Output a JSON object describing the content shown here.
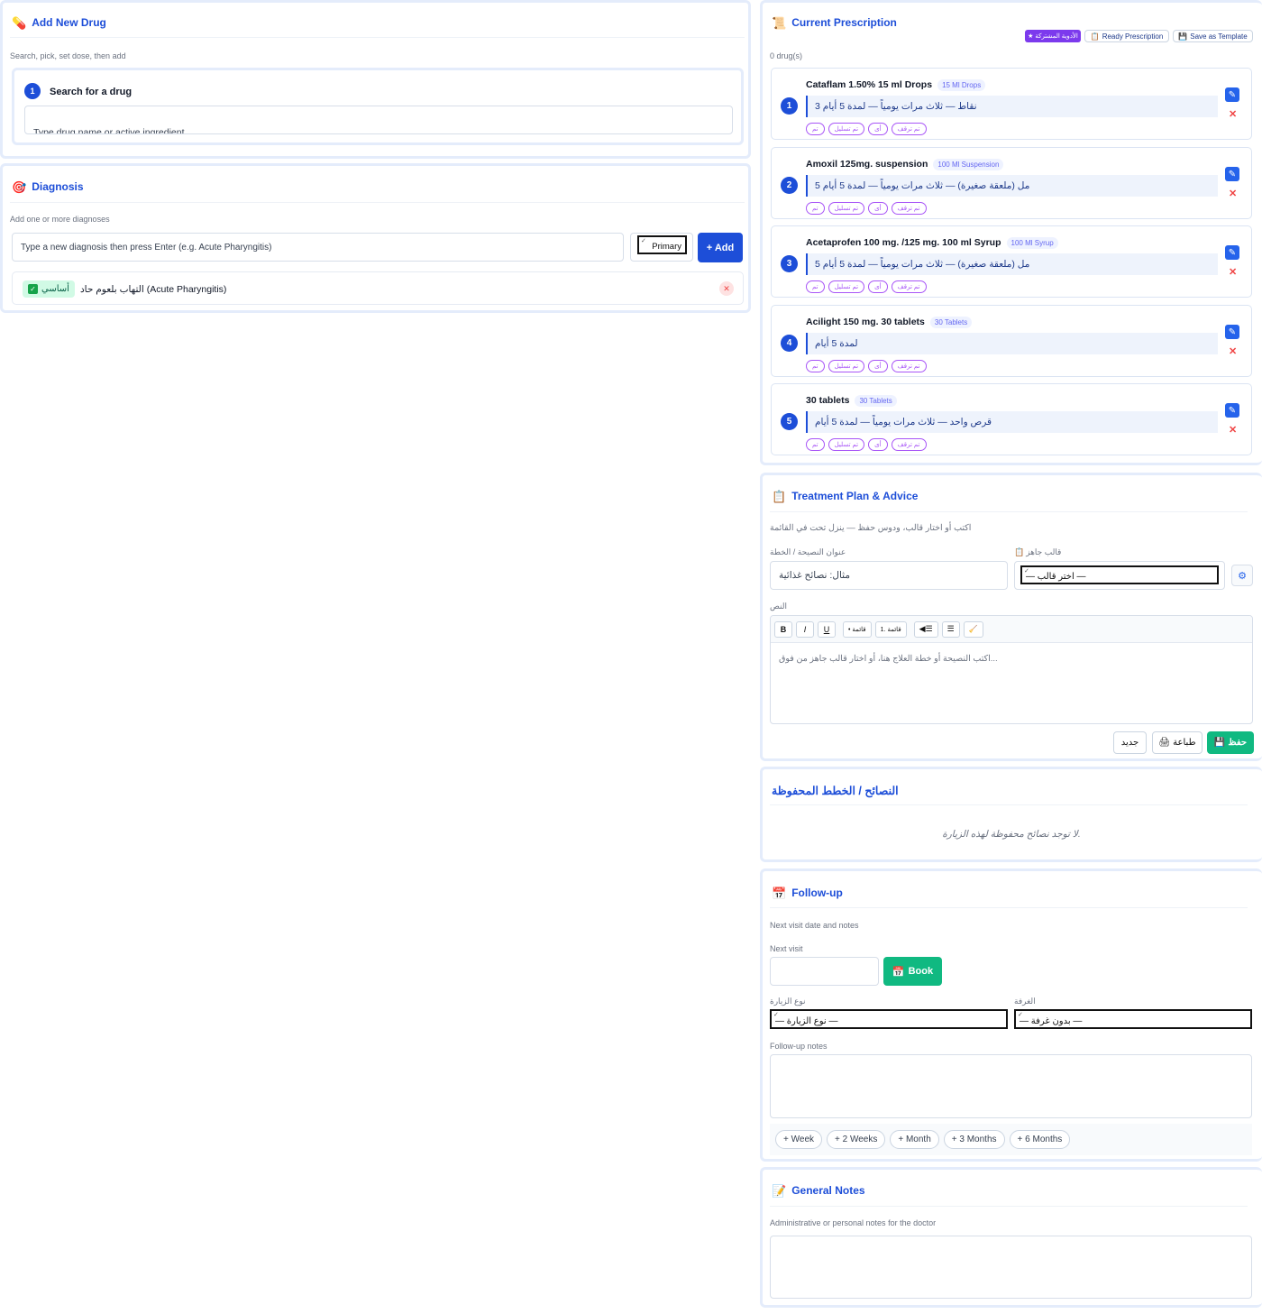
{
  "add_drug": {
    "title": "Add New Drug",
    "subtitle": "Search, pick, set dose, then add",
    "step_num": "1",
    "step_label": "Search for a drug",
    "search_placeholder": "Type drug name or active ingredient"
  },
  "diagnosis": {
    "title": "Diagnosis",
    "subtitle": "Add one or more diagnoses",
    "input_placeholder": "Type a new diagnosis then press Enter (e.g. Acute Pharyngitis)",
    "type_value": "Primary",
    "add_label": "+ Add",
    "items": [
      {
        "badge": "أساسي",
        "text": "التهاب بلعوم حاد (Acute Pharyngitis)"
      }
    ]
  },
  "prescription": {
    "title": "Current Prescription",
    "count": "0 drug(s)",
    "btn_shared": "★ الأدوية المشتركة",
    "btn_ready": "Ready Prescription",
    "btn_template": "Save as Template",
    "chip_labels": [
      "تم",
      "تم تسليل",
      "أى",
      "تم ترقف"
    ],
    "drugs": [
      {
        "num": "1",
        "name": "Cataflam 1.50% 15 ml Drops",
        "form": "15 Ml Drops",
        "instructions": "3 نقاط — ثلاث مرات يومياً — لمدة 5 أيام"
      },
      {
        "num": "2",
        "name": "Amoxil 125mg. suspension",
        "form": "100 Ml Suspension",
        "instructions": "5 مل (ملعقة صغيرة) — ثلاث مرات يومياً — لمدة 5 أيام"
      },
      {
        "num": "3",
        "name": "Acetaprofen 100 mg. /125 mg. 100 ml Syrup",
        "form": "100 Ml Syrup",
        "instructions": "5 مل (ملعقة صغيرة) — ثلاث مرات يومياً — لمدة 5 أيام"
      },
      {
        "num": "4",
        "name": "Acilight 150 mg. 30 tablets",
        "form": "30 Tablets",
        "instructions": "لمدة 5 أيام"
      },
      {
        "num": "5",
        "name": "30 tablets",
        "form": "30 Tablets",
        "instructions": "قرص واحد — ثلاث مرات يومياً — لمدة 5 أيام"
      }
    ]
  },
  "treatment": {
    "title": "Treatment Plan & Advice",
    "hint": "اكتب أو اختار قالب، ودوس حفظ — ينزل تحت في القائمة",
    "title_label": "عنوان النصيحة / الخطة",
    "title_placeholder": "مثال: نصائح غذائية",
    "template_label": "قالب جاهز",
    "template_value": "— اختر قالب —",
    "text_label": "النص",
    "text_placeholder": "اكتب النصيحة أو خطة العلاج هنا، أو اختار قالب جاهز من فوق...",
    "toolbar": {
      "bold": "B",
      "italic": "I",
      "underline": "U",
      "bullets": "• قائمة",
      "numbered": "1. قائمة",
      "rtl": "◀☰",
      "align": "☰",
      "clear": "🧹"
    },
    "btn_new": "جديد",
    "btn_print": "طباعة",
    "btn_save": "حفظ"
  },
  "saved": {
    "title": "النصائح / الخطط المحفوظة",
    "empty": "لا توجد نصائح محفوظة لهذه الزيارة."
  },
  "followup": {
    "title": "Follow-up",
    "subtitle": "Next visit date and notes",
    "next_label": "Next visit",
    "book_label": "Book",
    "type_label": "نوع الزيارة",
    "type_value": "— نوع الزيارة —",
    "room_label": "الغرفة",
    "room_value": "— بدون غرفة —",
    "notes_label": "Follow-up notes",
    "quick": [
      "+ Week",
      "+ 2 Weeks",
      "+ Month",
      "+ 3 Months",
      "+ 6 Months"
    ]
  },
  "notes": {
    "title": "General Notes",
    "subtitle": "Administrative or personal notes for the doctor"
  },
  "colors": {
    "primary": "#1d4ed8",
    "success": "#10b981",
    "purple": "#7c3aed",
    "danger": "#ef4444"
  }
}
